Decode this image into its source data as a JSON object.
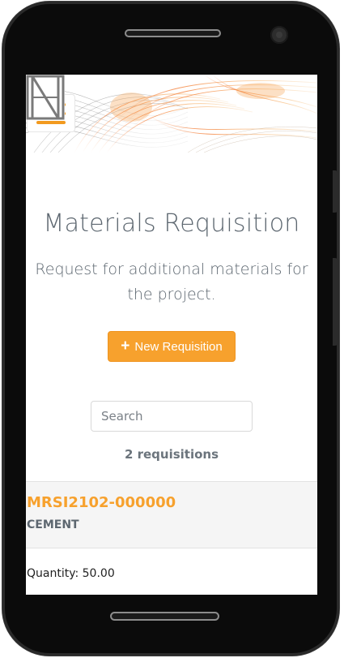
{
  "header": {
    "menu_icon": "hamburger-menu-icon",
    "logo_icon": "company-logo-icon",
    "accent_color": "#f7a12d"
  },
  "main": {
    "title": "Materials Requisition",
    "description": "Request for additional materials for the project.",
    "new_button_label": "New Requisition",
    "new_button_icon": "plus-icon",
    "search_placeholder": "Search",
    "search_value": "",
    "count_label": "2 requisitions"
  },
  "requisitions": [
    {
      "code": "MRSI2102-000000",
      "material": "CEMENT",
      "quantity": "Quantity: 50.00"
    }
  ]
}
